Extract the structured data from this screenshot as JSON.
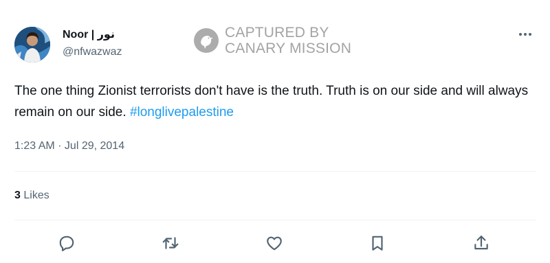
{
  "tweet": {
    "author": {
      "display_name": "Noor | نور",
      "handle": "@nfwazwaz",
      "avatar_icon": "profile-photo"
    },
    "watermark": {
      "line1": "CAPTURED BY",
      "line2": "CANARY MISSION",
      "logo_icon": "canary-bird-logo"
    },
    "text": "The one thing Zionist terrorists don't have is the truth. Truth is on our side and will always remain on our side.",
    "hashtag": "#longlivepalestine",
    "timestamp": "1:23 AM · Jul 29, 2014",
    "likes": {
      "count": "3",
      "label": "Likes"
    },
    "actions": [
      "reply-icon",
      "retweet-icon",
      "like-icon",
      "bookmark-icon",
      "share-icon"
    ]
  },
  "colors": {
    "text_primary": "#0f1419",
    "text_secondary": "#536471",
    "link": "#1d9bf0",
    "divider": "#eff3f4",
    "watermark": "#6b6b6b"
  }
}
